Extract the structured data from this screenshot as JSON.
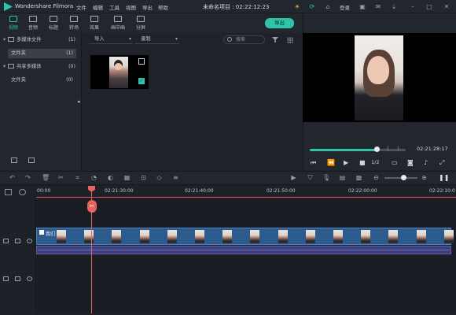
{
  "title_bar": {
    "app_name": "Wondershare Filmora",
    "menus": [
      "文件",
      "编辑",
      "工具",
      "视图",
      "导出",
      "帮助"
    ],
    "project": "未命名项目 : 02:22:12:23",
    "login": "登录",
    "icons": [
      "sun-icon",
      "sync-icon",
      "gift-icon",
      "save-icon",
      "mail-icon",
      "download-icon",
      "minimize-icon",
      "maximize-icon",
      "close-icon"
    ]
  },
  "media_tabs": [
    {
      "label": "视频",
      "icon": "folder-icon",
      "active": true
    },
    {
      "label": "音频",
      "icon": "music-icon",
      "active": false
    },
    {
      "label": "标题",
      "icon": "title-icon",
      "active": false
    },
    {
      "label": "转场",
      "icon": "transition-icon",
      "active": false
    },
    {
      "label": "效果",
      "icon": "effects-icon",
      "active": false
    },
    {
      "label": "画中画",
      "icon": "pip-icon",
      "active": false
    },
    {
      "label": "分屏",
      "icon": "split-screen-icon",
      "active": false
    }
  ],
  "export_label": "导出",
  "library": {
    "items": [
      {
        "label": "多媒体文件",
        "count": "(1)",
        "expanded": true
      },
      {
        "label": "文件夹",
        "count": "(1)",
        "selected": true
      },
      {
        "label": "共享多媒体",
        "count": "(0)",
        "expanded": true
      },
      {
        "label": "文件夹",
        "count": "(0)"
      }
    ]
  },
  "media": {
    "import_label": "导入",
    "record_label": "录制",
    "search_placeholder": "搜索"
  },
  "preview": {
    "timecode": "02:21:28:17",
    "ratio": "1/2",
    "progress": 0.7
  },
  "timeline": {
    "ticks": [
      "00:00",
      "02:21:30:00",
      "02:21:40:00",
      "02:21:50:00",
      "02:22:00:00",
      "02:22:10:0"
    ],
    "clip_label": "我们"
  },
  "colors": {
    "accent": "#2fc3a9",
    "playhead": "#e8635f",
    "video_track": "#2c5b8e",
    "audio_track": "#3c3f7a"
  }
}
